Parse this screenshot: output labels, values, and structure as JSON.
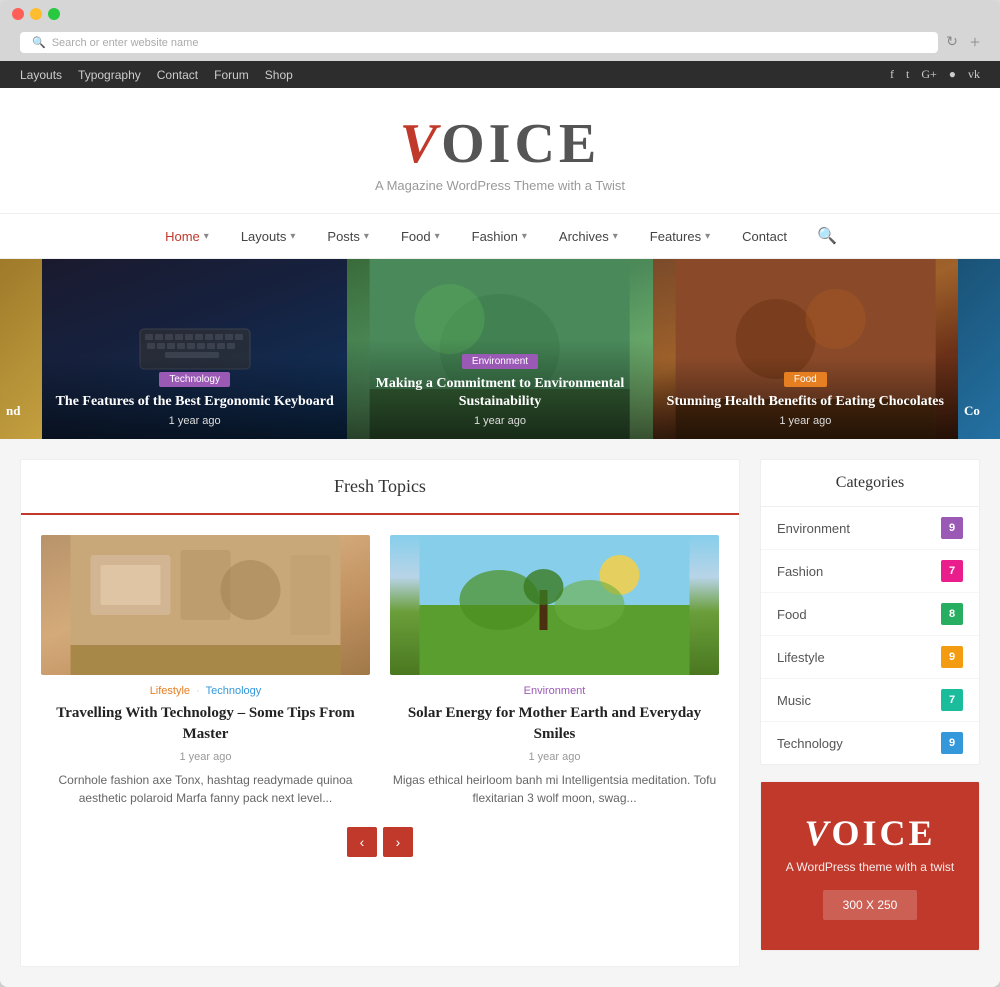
{
  "browser": {
    "address_placeholder": "Search or enter website name",
    "new_tab_label": "+"
  },
  "top_nav": {
    "items": [
      "Layouts",
      "Typography",
      "Contact",
      "Forum",
      "Shop"
    ]
  },
  "social": {
    "icons": [
      "f",
      "t",
      "g+",
      "📷",
      "vk"
    ]
  },
  "site": {
    "logo_v": "V",
    "logo_rest": "OICE",
    "tagline": "A Magazine WordPress Theme with a Twist"
  },
  "main_nav": {
    "items": [
      {
        "label": "Home",
        "has_dropdown": true,
        "active": true
      },
      {
        "label": "Layouts",
        "has_dropdown": true
      },
      {
        "label": "Posts",
        "has_dropdown": true
      },
      {
        "label": "Food",
        "has_dropdown": true
      },
      {
        "label": "Fashion",
        "has_dropdown": true
      },
      {
        "label": "Archives",
        "has_dropdown": true
      },
      {
        "label": "Features",
        "has_dropdown": true
      },
      {
        "label": "Contact",
        "has_dropdown": false
      }
    ]
  },
  "hero": {
    "slides": [
      {
        "badge": "Technology",
        "badge_class": "badge-tech",
        "title": "The Features of the Best Ergonomic Keyboard",
        "date": "1 year ago"
      },
      {
        "badge": "Environment",
        "badge_class": "badge-env",
        "title": "Making a Commitment to Environmental Sustainability",
        "date": "1 year ago"
      },
      {
        "badge": "Food",
        "badge_class": "badge-food",
        "title": "Stunning Health Benefits of Eating Chocolates",
        "date": "1 year ago"
      }
    ],
    "partial_left_text": "nd",
    "partial_right_text": "Co"
  },
  "fresh_topics": {
    "section_title": "Fresh Topics",
    "articles": [
      {
        "categories": [
          {
            "label": "Lifestyle",
            "class": "cat-lifestyle"
          },
          {
            "label": "Technology",
            "class": "cat-technology"
          }
        ],
        "title": "Travelling With Technology – Some Tips From Master",
        "date": "1 year ago",
        "excerpt": "Cornhole fashion axe Tonx, hashtag readymade quinoa aesthetic polaroid Marfa fanny pack next level..."
      },
      {
        "categories": [
          {
            "label": "Environment",
            "class": "cat-environment"
          }
        ],
        "title": "Solar Energy for Mother Earth and Everyday Smiles",
        "date": "1 year ago",
        "excerpt": "Migas ethical heirloom banh mi Intelligentsia meditation. Tofu flexitarian 3 wolf moon, swag..."
      }
    ],
    "pagination": {
      "prev": "‹",
      "next": "›"
    }
  },
  "sidebar": {
    "categories_title": "Categories",
    "categories": [
      {
        "label": "Environment",
        "count": "9",
        "count_class": "count-purple"
      },
      {
        "label": "Fashion",
        "count": "7",
        "count_class": "count-pink"
      },
      {
        "label": "Food",
        "count": "8",
        "count_class": "count-green"
      },
      {
        "label": "Lifestyle",
        "count": "9",
        "count_class": "count-yellow"
      },
      {
        "label": "Music",
        "count": "7",
        "count_class": "count-teal"
      },
      {
        "label": "Technology",
        "count": "9",
        "count_class": "count-blue"
      }
    ],
    "ad": {
      "logo_v": "V",
      "logo_rest": "OICE",
      "tagline": "A WordPress theme with a twist",
      "size": "300 X 250"
    }
  }
}
